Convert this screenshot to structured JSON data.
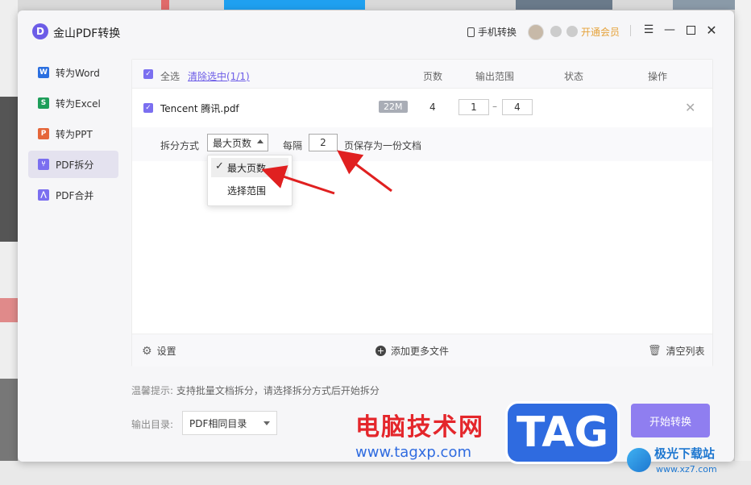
{
  "window": {
    "title": "金山PDF转换",
    "phone_convert": "手机转换",
    "vip_label": "开通会员"
  },
  "sidebar": {
    "items": [
      {
        "label": "转为Word",
        "icon": "word-icon",
        "color": "#2b6fe0"
      },
      {
        "label": "转为Excel",
        "icon": "excel-icon",
        "color": "#1e9e5a"
      },
      {
        "label": "转为PPT",
        "icon": "ppt-icon",
        "color": "#e5663a"
      },
      {
        "label": "PDF拆分",
        "icon": "split-icon",
        "color": "#7b6ff0",
        "active": true
      },
      {
        "label": "PDF合并",
        "icon": "merge-icon",
        "color": "#7b6ff0"
      }
    ]
  },
  "table": {
    "select_all": "全选",
    "clear_selected": "清除选中(1/1)",
    "col_pages": "页数",
    "col_range": "输出范围",
    "col_status": "状态",
    "col_action": "操作"
  },
  "file": {
    "name": "Tencent 腾讯.pdf",
    "size": "22M",
    "pages": "4",
    "range_from": "1",
    "range_sep": "–",
    "range_to": "4"
  },
  "split": {
    "method_label": "拆分方式",
    "method_value": "最大页数",
    "every_label": "每隔",
    "every_value": "2",
    "suffix": "页保存为一份文档",
    "options": [
      "最大页数",
      "选择范围"
    ]
  },
  "footer": {
    "settings": "设置",
    "add_more": "添加更多文件",
    "clear_list": "清空列表"
  },
  "tip": {
    "label": "温馨提示:",
    "text": "支持批量文档拆分，请选择拆分方式后开始拆分"
  },
  "output": {
    "label": "输出目录:",
    "value": "PDF相同目录"
  },
  "start_button": "开始转换",
  "watermark": {
    "line1": "电脑技术网",
    "line2": "www.tagxp.com",
    "tag": "TAG",
    "brand": "极光下载站",
    "brand_url": "www.xz7.com"
  }
}
